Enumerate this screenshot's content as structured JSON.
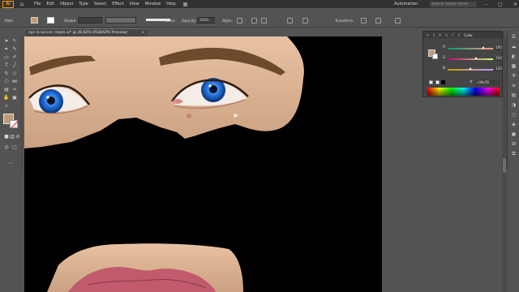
{
  "app": {
    "logo": "Ai",
    "menu": [
      "File",
      "Edit",
      "Object",
      "Type",
      "Select",
      "Effect",
      "View",
      "Window",
      "Help"
    ],
    "workspace": "Automation",
    "search_placeholder": "Search Adobe Stock"
  },
  "control_bar": {
    "selection_label": "Path",
    "stroke_label": "Stroke:",
    "stroke_style": "Basic",
    "opacity_label": "Opacity:",
    "opacity_value": "100%",
    "style_label": "Style:",
    "transform_label": "Transform",
    "fill_color": "#c39a78"
  },
  "document": {
    "tab_title": "eye in soccer cream.ai* @ 29,82% (RGB/GPU Preview)",
    "close": "×"
  },
  "color_panel": {
    "tabs": [
      "A",
      "S",
      "B",
      "G",
      "T",
      "C",
      "Color"
    ],
    "channels": [
      {
        "name": "R",
        "value": "195"
      },
      {
        "name": "G",
        "value": "154"
      },
      {
        "name": "B",
        "value": "120"
      }
    ],
    "hex_label": "#",
    "hex_value": "c39a78",
    "fill_color": "#c39a78"
  },
  "colors": {
    "skin": "#d9b08f",
    "skin_light": "#e8c2a2",
    "iris": "#1f6fd8",
    "brow": "#6e4a2c",
    "lips": "#c05a6c",
    "artboard_bg": "#000000"
  }
}
